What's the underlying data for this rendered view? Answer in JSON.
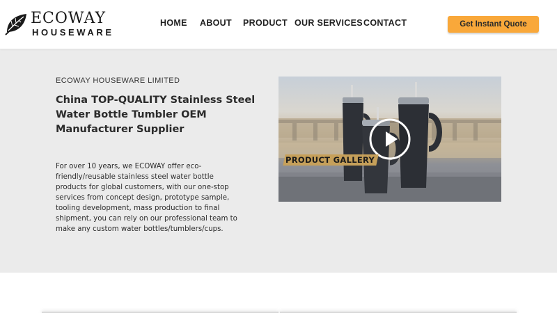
{
  "header": {
    "logo": {
      "name": "ECOWAY",
      "tagline": "HOUSEWARE"
    },
    "nav": [
      {
        "label": "HOME"
      },
      {
        "label": "ABOUT"
      },
      {
        "label": "PRODUCT"
      },
      {
        "label": "OUR SERVICES"
      },
      {
        "label": "CONTACT"
      }
    ],
    "cta_label": "Get Instant Quote"
  },
  "hero": {
    "company": "ECOWAY HOUSEWARE LIMITED",
    "headline": "China TOP-QUALITY Stainless Steel Water Bottle Tumbler OEM Manufacturer Supplier",
    "description": "For over 10 years, we ECOWAY offer eco-friendly/reusable stainless steel water bottle products for global customers, with our one-stop services from concept design, prototype sample, tooling development, mass production to final shipment, you can rely on our professional team to make any custom water bottles/tumblers/cups.",
    "video": {
      "label": "PRODUCT GALLERY",
      "icon": "play-icon"
    }
  },
  "colors": {
    "accent": "#f9a83a",
    "hero_bg": "#ebebeb",
    "gallery_label_bg": "#c6a05a"
  }
}
